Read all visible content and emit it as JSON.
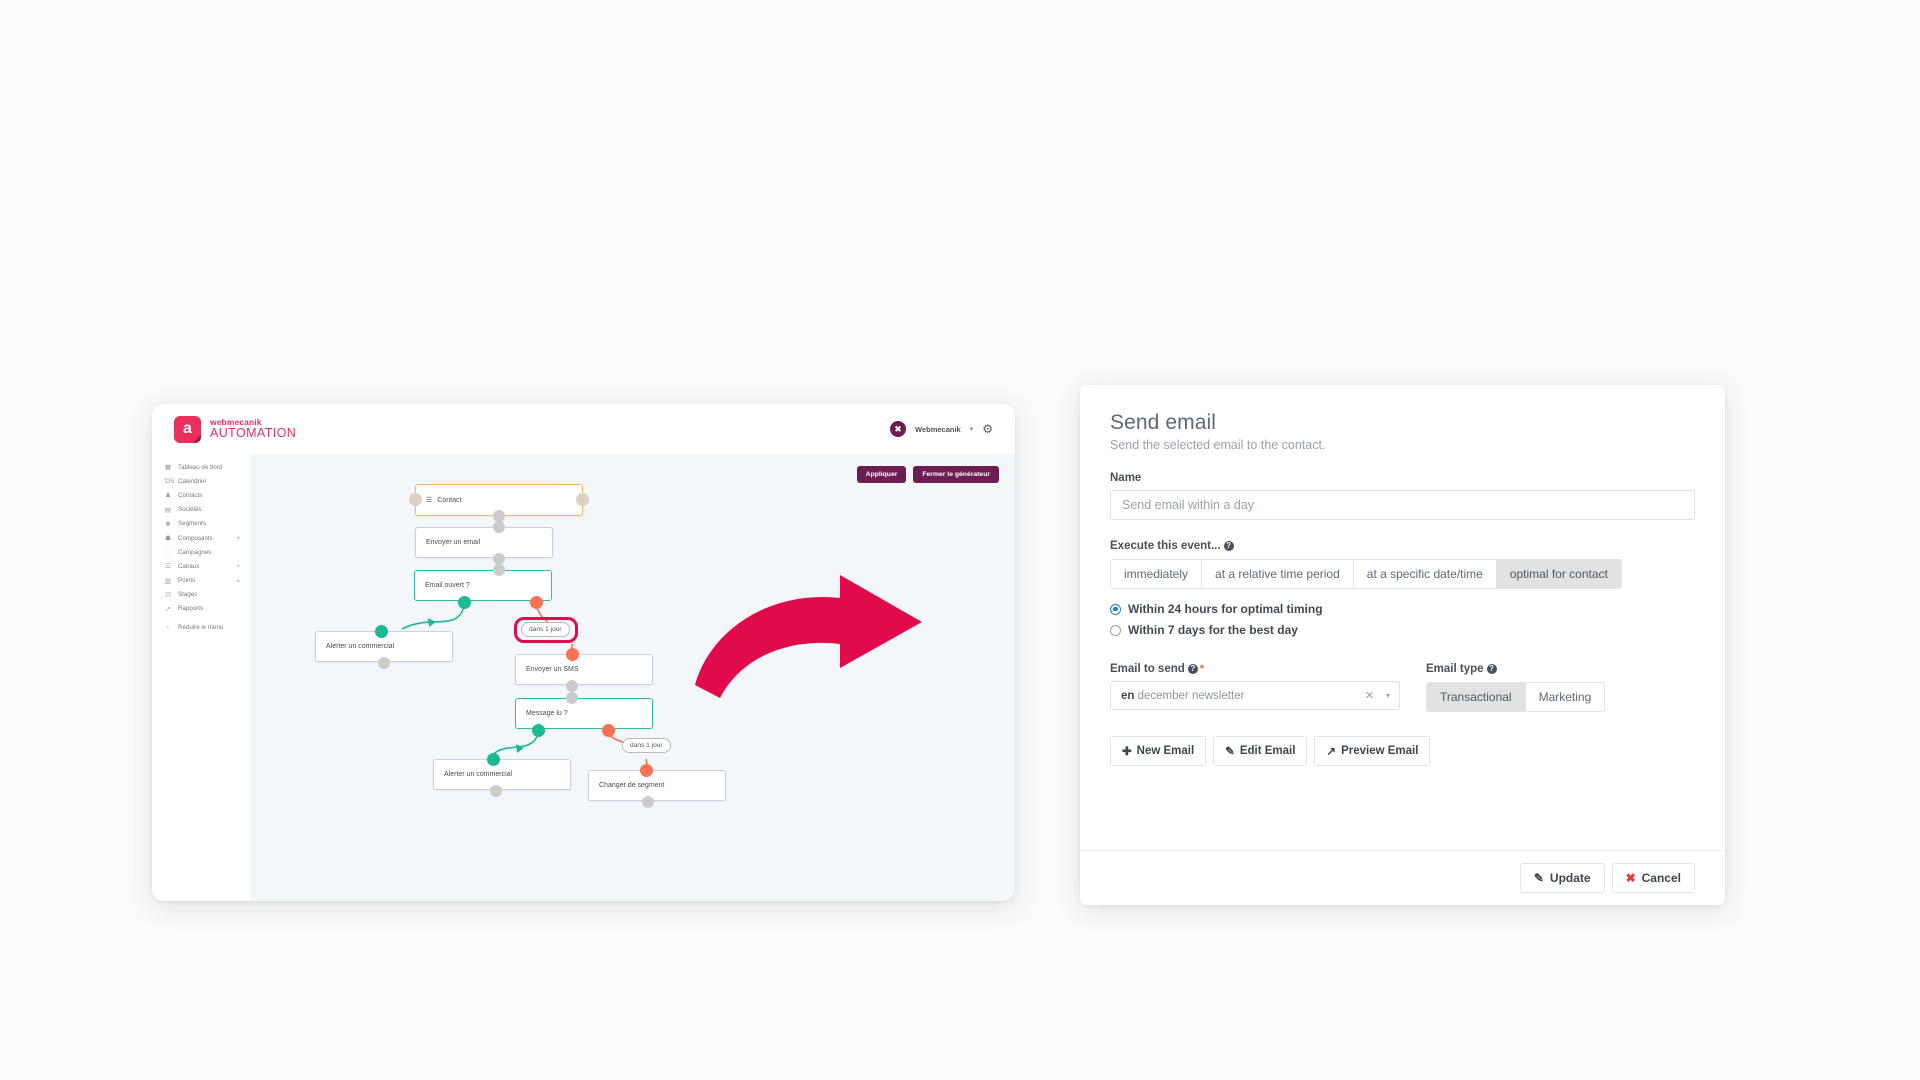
{
  "app": {
    "brand": {
      "name": "webmecanik",
      "sub": "AUTOMATION",
      "mark": "a"
    },
    "account": {
      "name": "Webmecanik",
      "caret": "▾",
      "avatar_icon": "webmecanik-mark",
      "gear_icon": "⚙"
    },
    "sidebar": {
      "items": [
        {
          "label": "Tableau de bord",
          "icon": "▦",
          "arrow": ""
        },
        {
          "label": "Calendrier",
          "icon": "Ὄ5",
          "arrow": ""
        },
        {
          "label": "Contacts",
          "icon": "♟",
          "arrow": ""
        },
        {
          "label": "Sociétés",
          "icon": "▤",
          "arrow": ""
        },
        {
          "label": "Segments",
          "icon": "❃",
          "arrow": ""
        },
        {
          "label": "Composants",
          "icon": "☗",
          "arrow": "▸"
        },
        {
          "label": "Campagnes",
          "icon": "◌",
          "arrow": ""
        },
        {
          "label": "Canaux",
          "icon": "☲",
          "arrow": "▸"
        },
        {
          "label": "Points",
          "icon": "▥",
          "arrow": "▸"
        },
        {
          "label": "Stages",
          "icon": "☷",
          "arrow": ""
        },
        {
          "label": "Rapports",
          "icon": "↗",
          "arrow": ""
        },
        {
          "label": "Réduire le menu",
          "icon": "‹",
          "arrow": ""
        }
      ]
    },
    "toolbar": {
      "apply_label": "Appliquer",
      "close_label": "Fermer le générateur"
    },
    "flow": {
      "nodes": [
        {
          "label": "Contact",
          "type": "source",
          "icon": "☰"
        },
        {
          "label": "Envoyer un email",
          "type": "action",
          "icon": ""
        },
        {
          "label": "Email ouvert ?",
          "type": "decision",
          "icon": ""
        },
        {
          "label": "Alerter un commercial",
          "type": "action",
          "icon": ""
        },
        {
          "label": "Envoyer un SMS",
          "type": "action",
          "icon": ""
        },
        {
          "label": "Message lu ?",
          "type": "decision",
          "icon": ""
        },
        {
          "label": "Alerter un commercial",
          "type": "action",
          "icon": ""
        },
        {
          "label": "Changer de segment",
          "type": "action",
          "icon": ""
        }
      ],
      "edge_labels": [
        {
          "label": "dans 1 jour",
          "highlighted": true
        },
        {
          "label": "dans 1 jour",
          "highlighted": false
        }
      ]
    },
    "colors": {
      "brand_pink": "#e8305f",
      "brand_purple": "#6d1d52",
      "node_source": "#f0b760",
      "node_action": "#c9cfe8",
      "node_decision": "#2fbda0",
      "port_green": "#1fb894",
      "port_orange": "#fa7252",
      "highlight_crimson": "#e10a4b",
      "canvas_bg": "#f3f7fa"
    }
  },
  "panel": {
    "title": "Send email",
    "subtitle": "Send the selected email to the contact.",
    "name": {
      "label": "Name",
      "placeholder": "Send email within a day",
      "value": ""
    },
    "execute": {
      "label": "Execute this event...",
      "help_icon": "?",
      "options": [
        {
          "label": "immediately",
          "active": false
        },
        {
          "label": "at a relative time period",
          "active": false
        },
        {
          "label": "at a specific date/time",
          "active": false
        },
        {
          "label": "optimal for contact",
          "active": true
        }
      ]
    },
    "timing_radios": [
      {
        "label": "Within 24 hours for optimal timing",
        "selected": true
      },
      {
        "label": "Within 7 days for the best day",
        "selected": false
      }
    ],
    "email_to_send": {
      "label": "Email to send",
      "help_icon": "?",
      "required_mark": "*",
      "lang": "en",
      "value": "december newsletter",
      "clear_icon": "✕",
      "caret_icon": "▾"
    },
    "email_type": {
      "label": "Email type",
      "help_icon": "?",
      "options": [
        {
          "label": "Transactional",
          "active": true
        },
        {
          "label": "Marketing",
          "active": false
        }
      ]
    },
    "email_actions": [
      {
        "label": "New Email",
        "icon": "✚"
      },
      {
        "label": "Edit Email",
        "icon": "✎"
      },
      {
        "label": "Preview Email",
        "icon": "↗"
      }
    ],
    "footer": [
      {
        "label": "Update",
        "icon": "✎",
        "style": "default"
      },
      {
        "label": "Cancel",
        "icon": "✖",
        "style": "danger"
      }
    ]
  }
}
